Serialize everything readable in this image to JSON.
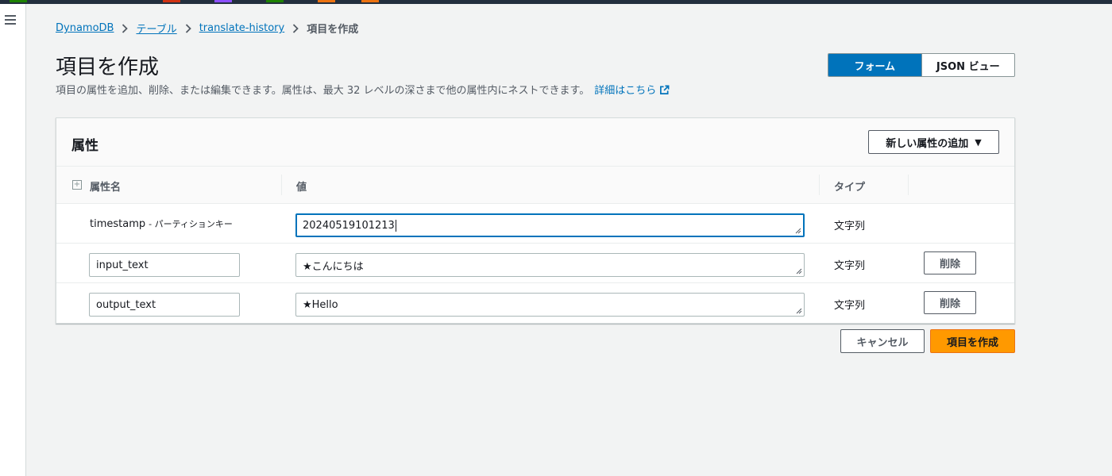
{
  "colors": {
    "accent": "#0073bb",
    "primary_button": "#ff9900",
    "top_bar": "#232f3e",
    "top_bar_marks": [
      "#1d8102",
      "#d13212",
      "#8c4fff",
      "#1d8102",
      "#ec7211",
      "#ec7211"
    ]
  },
  "nav": {
    "menu_icon": "hamburger-icon"
  },
  "breadcrumb": {
    "items": [
      "DynamoDB",
      "テーブル",
      "translate-history"
    ],
    "current": "項目を作成",
    "separator_icon": "chevron-right-icon"
  },
  "header": {
    "title": "項目を作成",
    "description": "項目の属性を追加、削除、または編集できます。属性は、最大 32 レベルの深さまで他の属性内にネストできます。",
    "learn_more": "詳細はこちら",
    "learn_more_icon": "external-link-icon"
  },
  "view_toggle": {
    "options": [
      "フォーム",
      "JSON ビュー"
    ],
    "selected": "フォーム"
  },
  "attributes_panel": {
    "title": "属性",
    "add_button_label": "新しい属性の追加",
    "add_button_icon": "caret-down-icon",
    "columns": [
      "属性名",
      "値",
      "タイプ"
    ],
    "expand_icon": "expand-all-icon",
    "rows": [
      {
        "name": "timestamp",
        "key_label": "- パーティションキー",
        "value": "20240519101213",
        "type": "文字列"
      },
      {
        "name": "input_text",
        "value": "★こんにちは",
        "type": "文字列",
        "delete_label": "削除"
      },
      {
        "name": "output_text",
        "value": "★Hello",
        "type": "文字列",
        "delete_label": "削除"
      }
    ]
  },
  "footer": {
    "cancel_label": "キャンセル",
    "create_label": "項目を作成"
  }
}
